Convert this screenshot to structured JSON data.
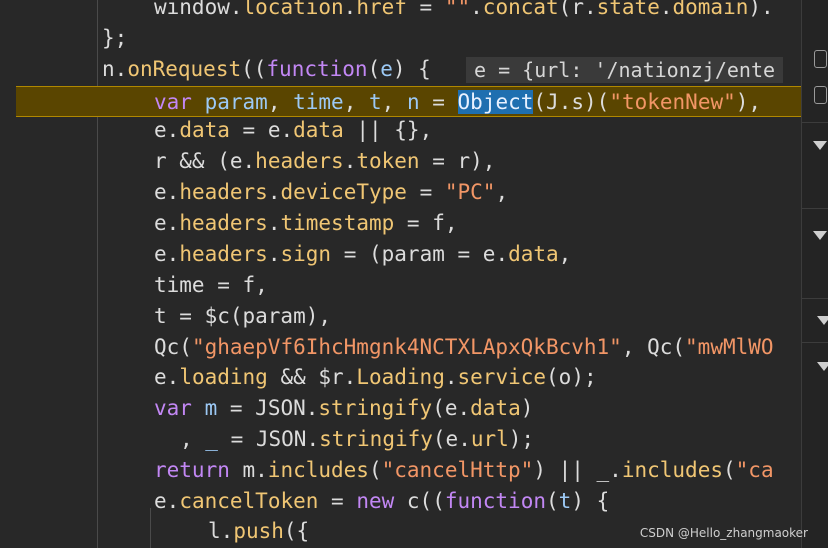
{
  "code": {
    "l0": {
      "a": "window",
      "b": ".",
      "c": "location",
      "d": ".",
      "e": "href",
      "f": " = ",
      "g": "\"\"",
      "h": ".",
      "i": "concat",
      "j": "(",
      "k": "r",
      "l": ".",
      "m": "state",
      "n": ".",
      "o": "domain",
      "p": ")."
    },
    "l1": {
      "a": "};"
    },
    "l2": {
      "a": "n",
      "b": ".",
      "c": "onRequest",
      "d": "((",
      "e": "function",
      "f": "(",
      "g": "e",
      "h": ") {"
    },
    "l2_inline": "e = {url: '/nationzj/ente",
    "l3": {
      "a": "var",
      "b": " ",
      "c": "param",
      "d": ", ",
      "e": "time",
      "f": ", ",
      "g": "t",
      "h": ", ",
      "i": "n",
      "j": " = ",
      "k": "Object",
      "l": "(",
      "m": "J",
      "n": ".",
      "o": "s",
      "p": ")(",
      "q": "\"tokenNew\"",
      "r": "),"
    },
    "l4": {
      "a": "e",
      "b": ".",
      "c": "data",
      "d": " = ",
      "e": "e",
      "f": ".",
      "g": "data",
      "h": " || {},"
    },
    "l5": {
      "a": "r && (",
      "b": "e",
      "c": ".",
      "d": "headers",
      "e": ".",
      "f": "token",
      "g": " = r),"
    },
    "l6": {
      "a": "e",
      "b": ".",
      "c": "headers",
      "d": ".",
      "e": "deviceType",
      "f": " = ",
      "g": "\"PC\"",
      "h": ","
    },
    "l7": {
      "a": "e",
      "b": ".",
      "c": "headers",
      "d": ".",
      "e": "timestamp",
      "f": " = f,"
    },
    "l8": {
      "a": "e",
      "b": ".",
      "c": "headers",
      "d": ".",
      "e": "sign",
      "f": " = (param = ",
      "g": "e",
      "h": ".",
      "i": "data",
      "j": ","
    },
    "l9": {
      "a": "time = f,"
    },
    "l10": {
      "a": "t = $c(param),"
    },
    "l11": {
      "a": "Qc(",
      "b": "\"ghaepVf6IhcHmgnk4NCTXLApxQkBcvh1\"",
      "c": ", Qc(",
      "d": "\"mwMlWO"
    },
    "l12": {
      "a": "e",
      "b": ".",
      "c": "loading",
      "d": " && $r.",
      "e": "Loading",
      "f": ".",
      "g": "service",
      "h": "(o);"
    },
    "l13": {
      "a": "var",
      "b": " ",
      "c": "m",
      "d": " = JSON.",
      "e": "stringify",
      "f": "(e.",
      "g": "data",
      "h": ")"
    },
    "l14": {
      "a": ", ",
      "b": "_",
      "c": " = JSON.",
      "d": "stringify",
      "e": "(e.",
      "f": "url",
      "g": ");"
    },
    "l15": {
      "a": "return",
      "b": " m.",
      "c": "includes",
      "d": "(",
      "e": "\"cancelHttp\"",
      "f": ") || _.",
      "g": "includes",
      "h": "(",
      "i": "\"ca"
    },
    "l16": {
      "a": "e",
      "b": ".",
      "c": "cancelToken",
      "d": " = ",
      "e": "new",
      "f": " c((",
      "g": "function",
      "h": "(",
      "i": "t",
      "j": ") {"
    },
    "l17": {
      "a": "l",
      "b": ".",
      "c": "push",
      "d": "({"
    }
  },
  "watermark": "CSDN @Hello_zhangmaoker"
}
